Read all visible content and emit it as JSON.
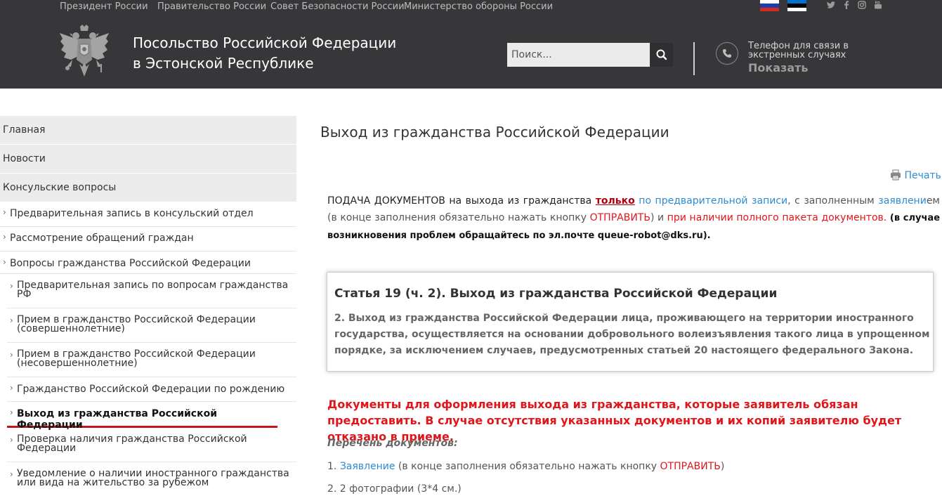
{
  "top_nav": {
    "links": [
      "Президент России",
      "Правительство России",
      "Совет Безопасности России",
      "Министерство обороны России"
    ]
  },
  "social": [
    "twitter-icon",
    "facebook-icon",
    "instagram-icon",
    "youtube-icon"
  ],
  "header": {
    "title_line1": "Посольство Российской Федерации",
    "title_line2": "в Эстонской Республике",
    "search_placeholder": "Поиск...",
    "phone_label_line1": "Телефон для связи в",
    "phone_label_line2": "экстренных случаях",
    "phone_show": "Показать"
  },
  "sidebar": {
    "top_items": [
      "Главная",
      "Новости",
      "Консульские вопросы"
    ],
    "sub_items": [
      "Предварительная запись в консульский отдел",
      "Рассмотрение обращений граждан",
      "Вопросы гражданства Российской Федерации"
    ],
    "nested_items": [
      {
        "line1": "Предварительная запись по вопросам гражданства",
        "line2": "РФ"
      },
      {
        "line1": "Прием в гражданство Российской Федерации",
        "line2": "(совершеннолетние)"
      },
      {
        "line1": "Прием в гражданство Российской Федерации",
        "line2": "(несовершеннолетние)"
      },
      {
        "line1": "Гражданство Российской Федерации по рождению",
        "line2": ""
      },
      {
        "line1": "Выход из гражданства Российской Федерации",
        "line2": ""
      },
      {
        "line1": "Проверка наличия гражданства Российской",
        "line2": "Федерации"
      },
      {
        "line1": "Уведомление о наличии иностранного гражданства",
        "line2": "или вида на жительство за рубежом"
      }
    ],
    "active_index": 4
  },
  "main": {
    "title": "Выход из гражданства Российской Федерации",
    "print_label": "Печать",
    "lead": {
      "p1": "ПОДАЧА ДОКУМЕНТОВ на выхода из гражданства ",
      "p2": "только",
      "p3": " ",
      "p4": "по предварительной записи",
      "p5": ", с заполненным ",
      "p6": "заявлени",
      "p7": "ем (в конце заполнения обязательно нажать кнопку ",
      "p8": "ОТПРАВИТЬ",
      "p9": ") и ",
      "p10": "при наличии полного пакета документов.",
      "p11": " (в случае возникновения проблем обращайтесь по эл.почте queue-robot@dks.ru)."
    },
    "article": {
      "heading": "Статья 19 (ч. 2). Выход из гражданства Российской Федерации",
      "text": "2. Выход из гражданства Российской Федерации лица, проживающего на территории иностранного государства, осуществляется на основании добровольного волеизъявления такого лица в упрощенном порядке, за исключением случаев, предусмотренных статьей 20 настоящего федерального Закона."
    },
    "docs_heading": "Документы для оформления выхода из гражданства, которые заявитель обязан предоставить. В случае отсутствия указанных документов и их копий заявителю будет отказано в приеме.",
    "docs_list_title": "Перечень документов:",
    "item1": {
      "num": "1. ",
      "link": "Заявление",
      "mid": " (в конце заполнения обязательно нажать кнопку ",
      "red": "ОТПРАВИТЬ",
      "end": ")"
    },
    "item2": "2. 2 фотографии (3*4 см.)"
  },
  "colors": {
    "header_bg": "#37373a",
    "link_blue": "#2e8bd1",
    "alert_red": "#e0161b",
    "dark_red": "#b0000e",
    "active_underline": "#c4161c"
  }
}
